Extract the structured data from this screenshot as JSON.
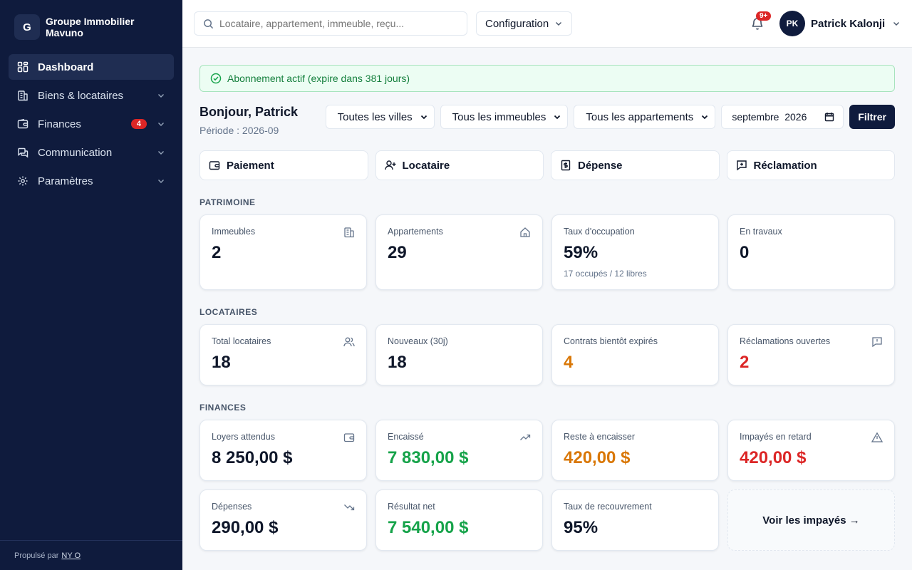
{
  "brand": {
    "initial": "G",
    "name": "Groupe Immobilier Mavuno"
  },
  "sidebar": {
    "items": [
      {
        "label": "Dashboard",
        "icon": "grid-icon",
        "active": true
      },
      {
        "label": "Biens & locataires",
        "icon": "building-icon"
      },
      {
        "label": "Finances",
        "icon": "wallet-icon",
        "badge": "4"
      },
      {
        "label": "Communication",
        "icon": "chat-icon"
      },
      {
        "label": "Paramètres",
        "icon": "gear-icon"
      }
    ],
    "footer_prefix": "Propulsé par",
    "footer_link": "NY O"
  },
  "topbar": {
    "search_placeholder": "Locataire, appartement, immeuble, reçu...",
    "config_label": "Configuration",
    "notif_badge": "9+",
    "user_initials": "PK",
    "user_name": "Patrick Kalonji"
  },
  "alert": {
    "text": "Abonnement actif (expire dans 381 jours)",
    "color": "#15803d"
  },
  "greeting": {
    "title": "Bonjour, Patrick",
    "period": "Période : 2026-09"
  },
  "filters": {
    "city": "Toutes les villes",
    "building": "Tous les immeubles",
    "apartment": "Tous les appartements",
    "month": "septembre  2026",
    "submit": "Filtrer"
  },
  "quick_actions": [
    {
      "label": "Paiement",
      "icon": "wallet-icon"
    },
    {
      "label": "Locataire",
      "icon": "user-plus-icon"
    },
    {
      "label": "Dépense",
      "icon": "receipt-icon"
    },
    {
      "label": "Réclamation",
      "icon": "message-plus-icon"
    }
  ],
  "sections": {
    "patrimoine": {
      "title": "PATRIMOINE",
      "cards": [
        {
          "label": "Immeubles",
          "value": "2",
          "icon": "building-icon"
        },
        {
          "label": "Appartements",
          "value": "29",
          "icon": "home-icon"
        },
        {
          "label": "Taux d'occupation",
          "value": "59%",
          "sub": "17 occupés / 12 libres"
        },
        {
          "label": "En travaux",
          "value": "0"
        }
      ]
    },
    "locataires": {
      "title": "LOCATAIRES",
      "cards": [
        {
          "label": "Total locataires",
          "value": "18",
          "icon": "users-icon"
        },
        {
          "label": "Nouveaux (30j)",
          "value": "18"
        },
        {
          "label": "Contrats bientôt expirés",
          "value": "4",
          "color": "#d97706"
        },
        {
          "label": "Réclamations ouvertes",
          "value": "2",
          "icon": "alert-message-icon",
          "color": "#dc2626"
        }
      ]
    },
    "finances": {
      "title": "FINANCES",
      "cards": [
        {
          "label": "Loyers attendus",
          "value": "8 250,00 $",
          "icon": "wallet-icon"
        },
        {
          "label": "Encaissé",
          "value": "7 830,00 $",
          "icon": "trend-up-icon",
          "color": "#16a34a"
        },
        {
          "label": "Reste à encaisser",
          "value": "420,00 $",
          "color": "#d97706"
        },
        {
          "label": "Impayés en retard",
          "value": "420,00 $",
          "icon": "warning-icon",
          "color": "#dc2626"
        },
        {
          "label": "Dépenses",
          "value": "290,00 $",
          "icon": "trend-down-icon"
        },
        {
          "label": "Résultat net",
          "value": "7 540,00 $",
          "color": "#16a34a"
        },
        {
          "label": "Taux de recouvrement",
          "value": "95%"
        }
      ],
      "link": "Voir les impayés →"
    }
  }
}
